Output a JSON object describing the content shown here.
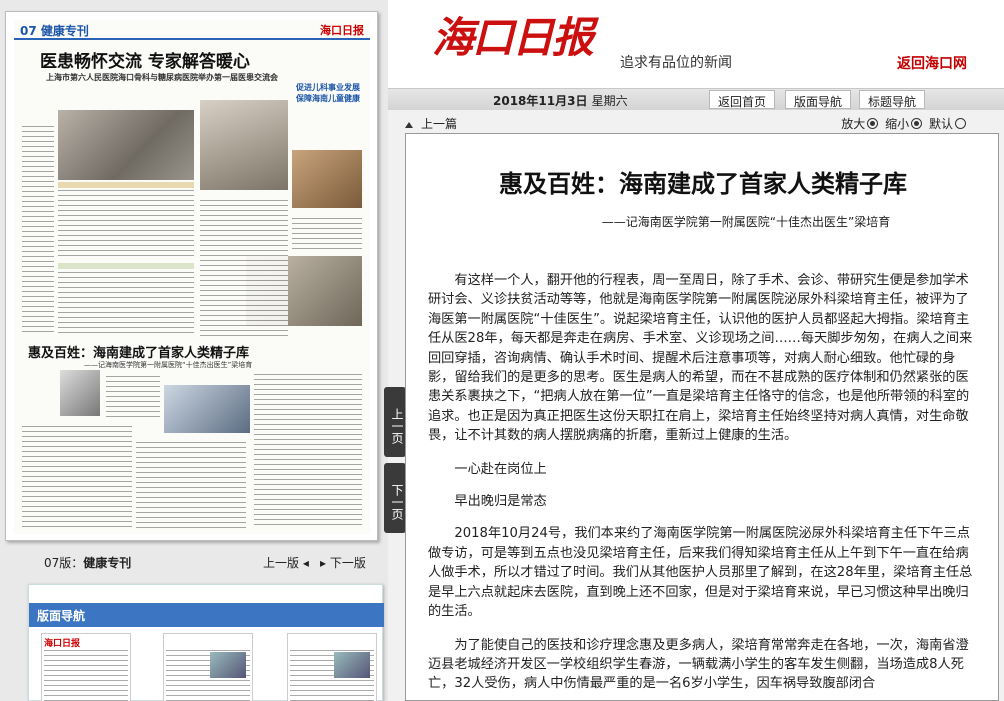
{
  "masthead": {
    "logo": "海口日报",
    "slogan": "追求有品位的新闻",
    "back_link": "返回海口网"
  },
  "toolbar": {
    "date": "2018年11月3日",
    "weekday": "星期六",
    "buttons": [
      "返回首页",
      "版面导航",
      "标题导航"
    ]
  },
  "article_bar": {
    "prev_article": "上一篇",
    "zoom_in": "放大",
    "zoom_out": "缩小",
    "zoom_default": "默认"
  },
  "side_tabs": {
    "prev_page": "上一页",
    "next_page": "下一页"
  },
  "thumb_page": {
    "section": "07 健康专刊",
    "logo": "海口日报",
    "headline": "医患畅怀交流 专家解答暖心",
    "subheadline": "上海市第六人民医院海口骨科与糖尿病医院举办第一届医患交流会",
    "side_headline": "促进儿科事业发展 保障海南儿童健康",
    "headline2": "惠及百姓：海南建成了首家人类精子库",
    "subheadline2": "——记海南医学院第一附属医院“十佳杰出医生”梁培育"
  },
  "page_nav": {
    "issue": "07版：",
    "section_name": "健康专刊",
    "prev": "上一版",
    "next": "下一版"
  },
  "nav_panel": {
    "title": "版面导航",
    "thumbs": [
      "海口日报",
      "",
      ""
    ]
  },
  "article": {
    "title": "惠及百姓：海南建成了首家人类精子库",
    "subtitle": "——记海南医学院第一附属医院“十佳杰出医生”梁培育",
    "paragraphs": [
      "有这样一个人，翻开他的行程表，周一至周日，除了手术、会诊、带研究生便是参加学术研讨会、义诊扶贫活动等等，他就是海南医学院第一附属医院泌尿外科梁培育主任，被评为了海医第一附属医院“十佳医生”。说起梁培育主任，认识他的医护人员都竖起大拇指。梁培育主任从医28年，每天都是奔走在病房、手术室、义诊现场之间……每天脚步匆匆，在病人之间来回回穿插，咨询病情、确认手术时间、提醒术后注意事项等，对病人耐心细致。他忙碌的身影，留给我们的是更多的思考。医生是病人的希望，而在不甚成熟的医疗体制和仍然紧张的医患关系裹挟之下，“把病人放在第一位”一直是梁培育主任恪守的信念，也是他所带领的科室的追求。也正是因为真正把医生这份天职扛在肩上，梁培育主任始终坚持对病人真情，对生命敬畏，让不计其数的病人摆脱病痛的折磨，重新过上健康的生活。",
      "一心赴在岗位上",
      "早出晚归是常态",
      "2018年10月24号，我们本来约了海南医学院第一附属医院泌尿外科梁培育主任下午三点做专访，可是等到五点也没见梁培育主任，后来我们得知梁培育主任从上午到下午一直在给病人做手术，所以才错过了时间。我们从其他医护人员那里了解到，在这28年里，梁培育主任总是早上六点就起床去医院，直到晚上还不回家，但是对于梁培育来说，早已习惯这种早出晚归的生活。",
      "为了能使自己的医技和诊疗理念惠及更多病人，梁培育常常奔走在各地，一次，海南省澄迈县老城经济开发区一学校组织学生春游，一辆载满小学生的客车发生侧翻，当场造成8人死亡，32人受伤，病人中伤情最严重的是一名6岁小学生，因车祸导致腹部闭合"
    ]
  }
}
